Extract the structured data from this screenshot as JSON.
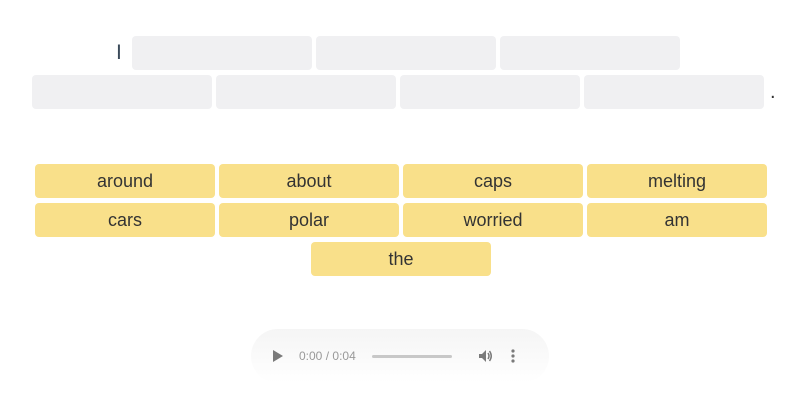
{
  "sentence": {
    "prefix": "I",
    "suffix": "."
  },
  "word_bank": [
    "around",
    "about",
    "caps",
    "melting",
    "cars",
    "polar",
    "worried",
    "am",
    "the"
  ],
  "audio": {
    "current_time": "0:00",
    "separator": "/",
    "duration": "0:04",
    "progress": 0,
    "icons": {
      "play": "play-icon",
      "volume": "volume-icon",
      "menu": "more-vertical-icon"
    }
  },
  "colors": {
    "chip_fill": "#f9e08a",
    "slot_fill": "#f0f0f2",
    "text": "#333333"
  }
}
